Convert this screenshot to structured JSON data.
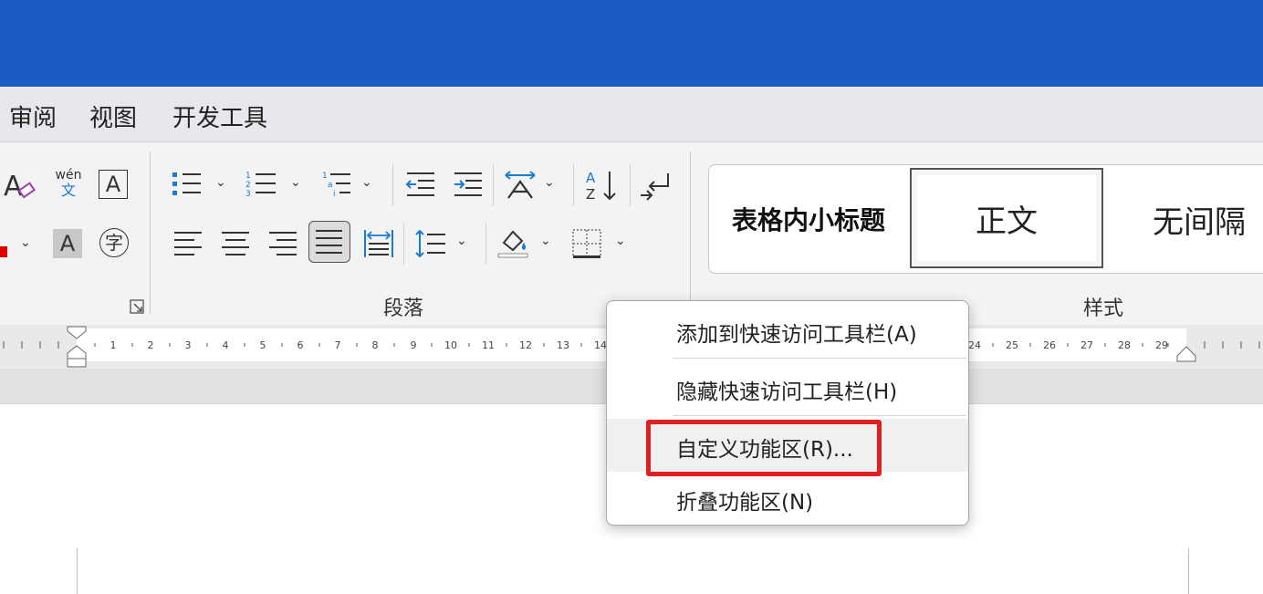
{
  "tabs": [
    "审阅",
    "视图",
    "开发工具"
  ],
  "ribbon": {
    "wen_label": "wén",
    "wen_char": "文",
    "A_box": "A",
    "A_shaded": "A",
    "zi": "字",
    "paragraph_label": "段落",
    "styles_label": "样式"
  },
  "styles": {
    "items": [
      "表格内小标题",
      "正文",
      "无间隔"
    ]
  },
  "ruler": {
    "numbers_left": [
      "1",
      "2",
      "3",
      "4",
      "5",
      "6",
      "7",
      "8",
      "9",
      "10",
      "11",
      "12",
      "13",
      "14"
    ],
    "numbers_right": [
      "24",
      "25",
      "26",
      "27",
      "28",
      "29"
    ]
  },
  "context_menu": {
    "items": [
      "添加到快速访问工具栏(A)",
      "隐藏快速访问工具栏(H)",
      "自定义功能区(R)...",
      "折叠功能区(N)"
    ]
  },
  "colors": {
    "titlebar": "#1b5ac0",
    "accent_blue": "#1a7ad4",
    "highlight_red": "#e02020"
  }
}
